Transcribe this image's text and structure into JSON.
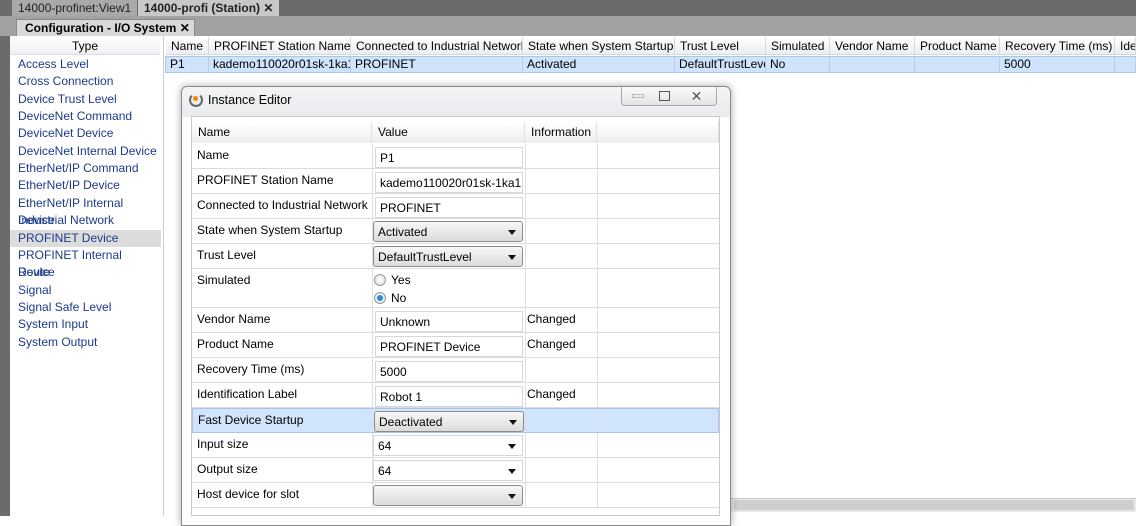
{
  "doc_tabs": [
    {
      "label": "14000-profinet:View1"
    },
    {
      "label": "14000-profi (Station)",
      "close": "✕"
    }
  ],
  "sub_tab": {
    "label": "Configuration - I/O System",
    "close": "✕"
  },
  "type_panel": {
    "header": "Type",
    "selected": "PROFINET Device",
    "items": [
      "Access Level",
      "Cross Connection",
      "Device Trust Level",
      "DeviceNet Command",
      "DeviceNet Device",
      "DeviceNet Internal Device",
      "EtherNet/IP Command",
      "EtherNet/IP Device",
      "EtherNet/IP Internal Device",
      "Industrial Network",
      "PROFINET Device",
      "PROFINET Internal Device",
      "Route",
      "Signal",
      "Signal Safe Level",
      "System Input",
      "System Output"
    ]
  },
  "grid": {
    "columns": [
      "Name",
      "PROFINET Station Name",
      "Connected to Industrial Network",
      "State when System Startup",
      "Trust Level",
      "Simulated",
      "Vendor Name",
      "Product Name",
      "Recovery Time (ms)",
      "Ide"
    ],
    "rows": [
      [
        "P1",
        "kademo110020r01sk-1ka1",
        "PROFINET",
        "Activated",
        "DefaultTrustLevel",
        "No",
        "",
        "",
        "5000",
        ""
      ]
    ],
    "sorted_column": "Name"
  },
  "editor": {
    "title": "Instance Editor",
    "columns": [
      "Name",
      "Value",
      "Information"
    ],
    "rows": [
      {
        "name": "Name",
        "type": "text",
        "value": "P1",
        "info": ""
      },
      {
        "name": "PROFINET Station Name",
        "type": "text",
        "value": "kademo110020r01sk-1ka1",
        "info": ""
      },
      {
        "name": "Connected to Industrial Network",
        "type": "text",
        "value": "PROFINET",
        "info": ""
      },
      {
        "name": "State when System Startup",
        "type": "dropdown",
        "value": "Activated",
        "info": ""
      },
      {
        "name": "Trust Level",
        "type": "dropdown",
        "value": "DefaultTrustLevel",
        "info": ""
      },
      {
        "name": "Simulated",
        "type": "radio",
        "options": [
          "Yes",
          "No"
        ],
        "value": "No",
        "info": ""
      },
      {
        "name": "Vendor Name",
        "type": "text",
        "value": "Unknown",
        "info": "Changed"
      },
      {
        "name": "Product Name",
        "type": "text",
        "value": "PROFINET Device",
        "info": "Changed"
      },
      {
        "name": "Recovery Time (ms)",
        "type": "text",
        "value": "5000",
        "info": ""
      },
      {
        "name": "Identification Label",
        "type": "text",
        "value": "Robot 1",
        "info": "Changed"
      },
      {
        "name": "Fast Device Startup",
        "type": "dropdown",
        "value": "Deactivated",
        "info": "",
        "selected": true
      },
      {
        "name": "Input size",
        "type": "dropdown-plain",
        "value": "64",
        "info": ""
      },
      {
        "name": "Output size",
        "type": "dropdown-plain",
        "value": "64",
        "info": ""
      },
      {
        "name": "Host device for slot",
        "type": "dropdown",
        "value": "",
        "info": ""
      }
    ]
  },
  "colors": {
    "selection": "#cfe3fb",
    "link": "#1b3a8a",
    "chrome": "#6b6b6b"
  }
}
